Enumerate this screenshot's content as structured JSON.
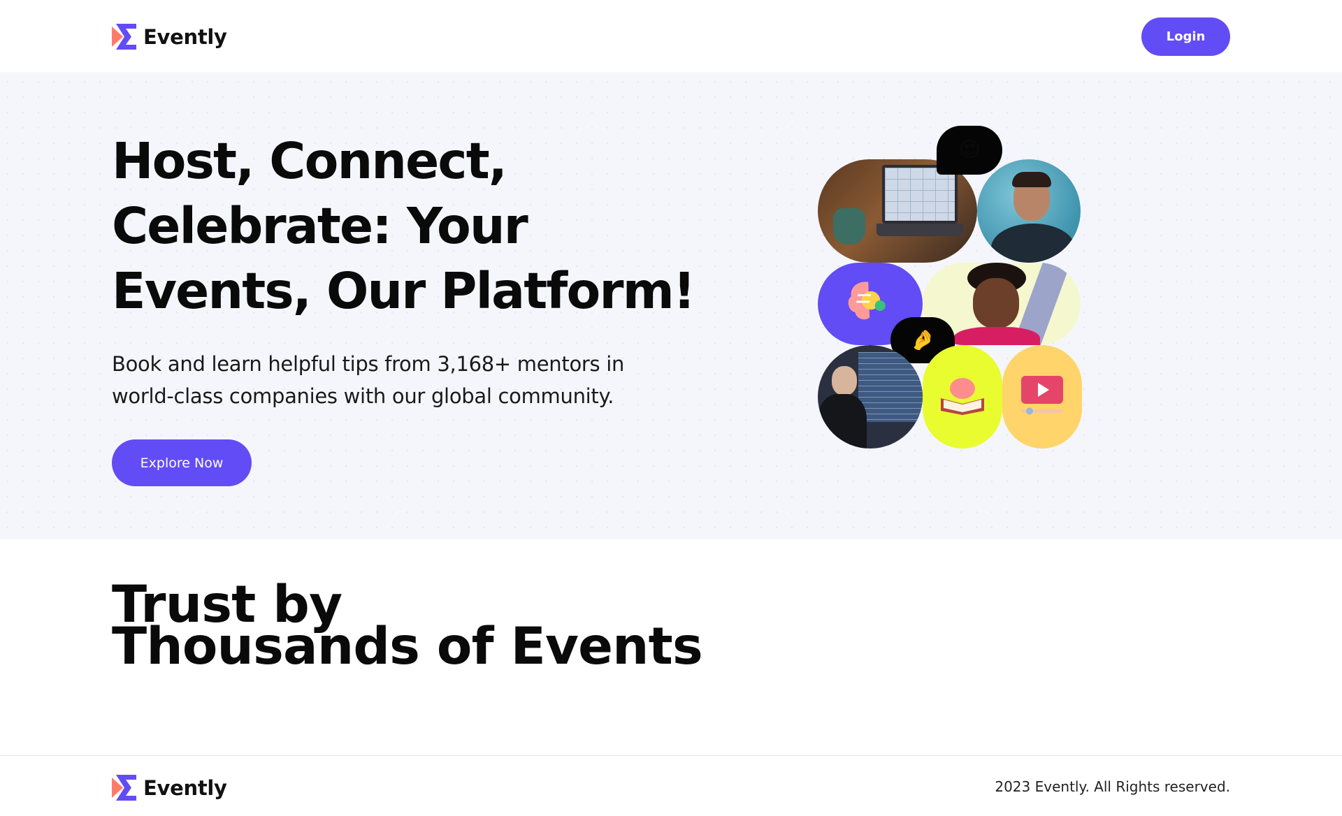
{
  "header": {
    "brand": "Evently",
    "login_label": "Login"
  },
  "hero": {
    "title": "Host, Connect, Celebrate: Your Events, Our Platform!",
    "subtitle": "Book and learn helpful tips from 3,168+ mentors in world-class companies with our global community.",
    "cta_label": "Explore Now",
    "bubble_1_emoji": "😍",
    "bubble_2_emoji": "🤌"
  },
  "trust": {
    "line_1": "Trust by",
    "line_2": "Thousands of Events"
  },
  "footer": {
    "brand": "Evently",
    "copyright": "2023 Evently. All Rights reserved."
  },
  "colors": {
    "primary": "#624cf5",
    "hero_bg": "#f5f6fc",
    "logo_coral": "#ff7a6b",
    "tile_yellow": "#e8fc30",
    "tile_orange": "#ffd46a",
    "tile_purple": "#624cf5"
  },
  "icons": [
    "evently-logo-icon",
    "brain-gear-icon",
    "brain-book-icon",
    "video-play-icon"
  ]
}
